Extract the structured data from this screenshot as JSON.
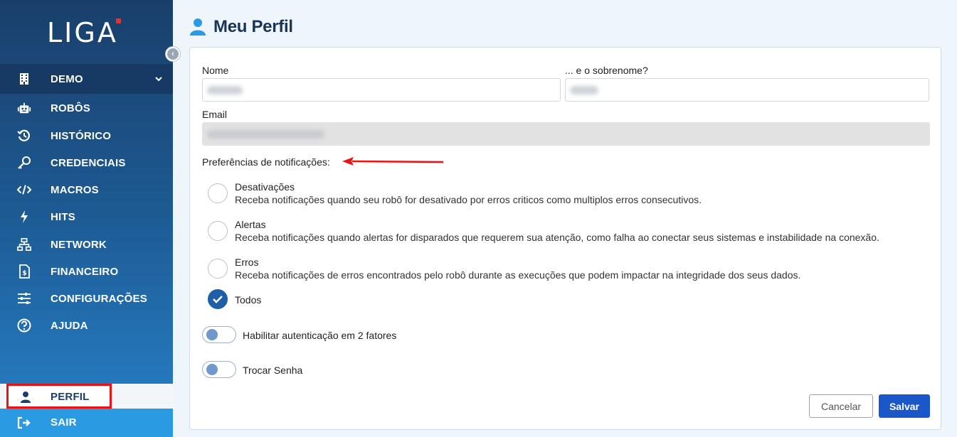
{
  "brand": {
    "logo_text": "LIGA"
  },
  "sidebar": {
    "org": {
      "label": "DEMO",
      "icon": "building-icon"
    },
    "items": [
      {
        "label": "ROBÔS",
        "icon": "robot-icon"
      },
      {
        "label": "HISTÓRICO",
        "icon": "history-icon"
      },
      {
        "label": "CREDENCIAIS",
        "icon": "key-icon"
      },
      {
        "label": "MACROS",
        "icon": "code-icon"
      },
      {
        "label": "HITS",
        "icon": "bolt-icon"
      },
      {
        "label": "NETWORK",
        "icon": "network-icon"
      },
      {
        "label": "FINANCEIRO",
        "icon": "invoice-icon"
      },
      {
        "label": "CONFIGURAÇÕES",
        "icon": "sliders-icon"
      },
      {
        "label": "AJUDA",
        "icon": "help-icon"
      }
    ],
    "perfil": {
      "label": "PERFIL",
      "icon": "user-icon"
    },
    "sair": {
      "label": "SAIR",
      "icon": "logout-icon"
    }
  },
  "page": {
    "title": "Meu Perfil",
    "icon": "user-icon"
  },
  "form": {
    "nome_label": "Nome",
    "sobrenome_label": "... e o sobrenome?",
    "email_label": "Email",
    "preferences_label": "Preferências de notificações:",
    "options": [
      {
        "title": "Desativações",
        "description": "Receba notificações quando seu robô for desativado por erros criticos como multiplos erros consecutivos.",
        "checked": false
      },
      {
        "title": "Alertas",
        "description": "Receba notificações quando alertas for disparados que requerem sua atenção, como falha ao conectar seus sistemas e instabilidade na conexão.",
        "checked": false
      },
      {
        "title": "Erros",
        "description": "Receba notificações de erros encontrados pelo robô durante as execuções que podem impactar na integridade dos seus dados.",
        "checked": false
      },
      {
        "title": "Todos",
        "description": "",
        "checked": true
      }
    ],
    "toggles": [
      {
        "label": "Habilitar autenticação em 2 fatores",
        "on": false
      },
      {
        "label": "Trocar Senha",
        "on": false
      }
    ],
    "cancel_label": "Cancelar",
    "save_label": "Salvar"
  },
  "colors": {
    "accent": "#1b57c9",
    "sidebar": "#1d5a93",
    "highlight": "#e11111"
  }
}
